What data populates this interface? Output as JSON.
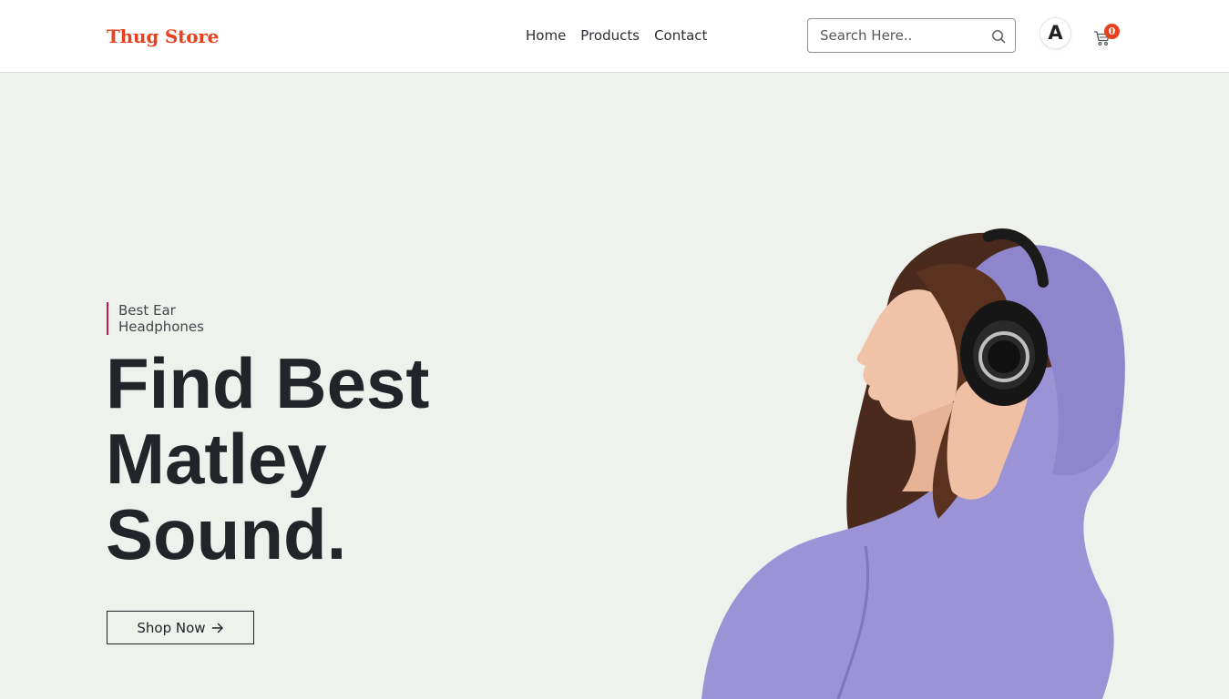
{
  "header": {
    "brand": "Thug Store",
    "nav": [
      "Home",
      "Products",
      "Contact"
    ],
    "search": {
      "placeholder": "Search Here..",
      "value": ""
    },
    "account_letter": "A",
    "cart_count": "0",
    "icons": [
      "search-icon",
      "account-icon",
      "cart-icon"
    ]
  },
  "hero": {
    "tagline": "Best Ear Headphones",
    "title_lines": [
      "Find Best",
      "Matley",
      "Sound."
    ],
    "cta_label": "Shop Now"
  },
  "colors": {
    "brand": "#e8411d",
    "accent_bar": "#c4164f",
    "hero_bg": "#eff1ec",
    "hoodie": "#9c93d6",
    "text": "#212429"
  }
}
